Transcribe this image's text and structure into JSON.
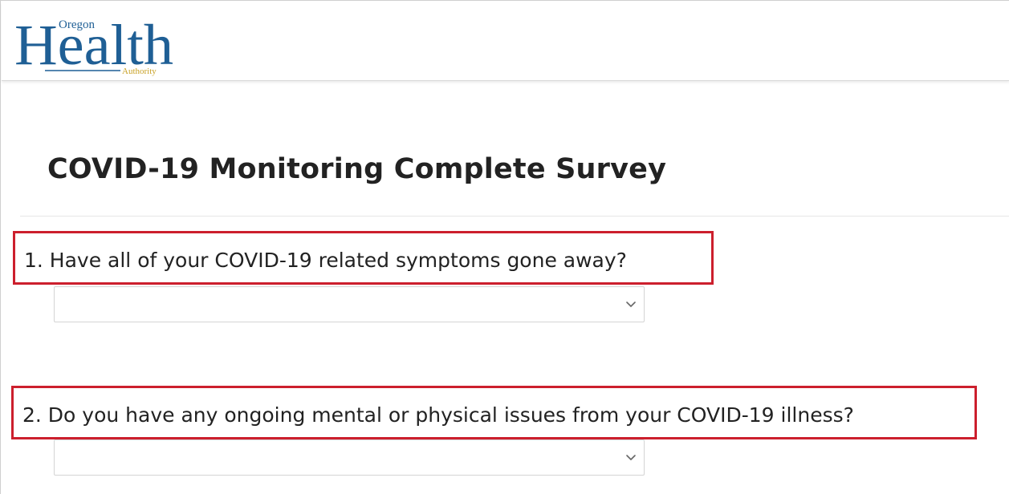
{
  "header": {
    "logo": {
      "main": "Health",
      "top_small": "Oregon",
      "bottom_small": "Authority",
      "color": "#1f5f95"
    }
  },
  "page": {
    "title": "COVID-19 Monitoring Complete Survey"
  },
  "questions": [
    {
      "label": "1. Have all of your COVID-19 related symptoms gone away?",
      "selected_value": ""
    },
    {
      "label": "2. Do you have any ongoing mental or physical issues from your COVID-19 illness?",
      "selected_value": ""
    }
  ],
  "icons": {
    "dropdown": "chevron-down-icon"
  },
  "colors": {
    "highlight_border": "#cc1f2d",
    "text": "#222222"
  }
}
